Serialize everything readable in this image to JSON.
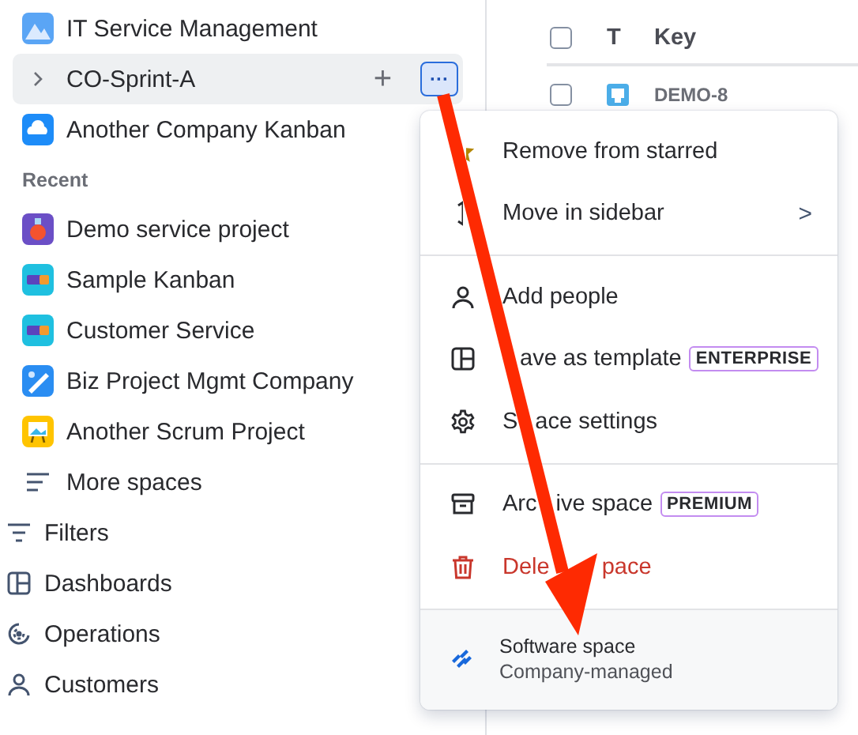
{
  "sidebar": {
    "starred": [
      {
        "label": "IT Service Management",
        "selected": false
      },
      {
        "label": "CO-Sprint-A",
        "selected": true,
        "expanded": false,
        "add_button": "+",
        "more_button": "···"
      },
      {
        "label": "Another Company Kanban",
        "selected": false
      }
    ],
    "recent_heading": "Recent",
    "recent": [
      {
        "label": "Demo service project",
        "selected": false
      },
      {
        "label": "Sample Kanban",
        "selected": false
      },
      {
        "label": "Customer Service",
        "selected": false
      },
      {
        "label": "Biz Project Mgmt Company",
        "selected": false
      },
      {
        "label": "Another Scrum Project",
        "selected": false
      }
    ],
    "more_spaces": "More spaces",
    "nav": [
      {
        "label": "Filters",
        "selected": false
      },
      {
        "label": "Dashboards",
        "selected": false
      },
      {
        "label": "Operations",
        "selected": false
      },
      {
        "label": "Customers",
        "selected": false
      }
    ]
  },
  "table": {
    "columns": [
      "T",
      "Key"
    ],
    "header_checked": false,
    "rows": [
      {
        "key": "DEMO-8",
        "checked": false
      }
    ]
  },
  "menu": {
    "sections": [
      [
        {
          "label": [
            "Remove from starred"
          ],
          "kind": "normal"
        },
        {
          "label": [
            "Move in sidebar"
          ],
          "kind": "submenu",
          "submenu_glyph": ">"
        }
      ],
      [
        {
          "label": [
            "Add people"
          ],
          "kind": "normal"
        },
        {
          "label": [
            "ave as template"
          ],
          "kind": "normal",
          "badge": "ENTERPRISE"
        },
        {
          "label": [
            "S",
            "ace settings"
          ],
          "kind": "normal"
        }
      ],
      [
        {
          "label": [
            "Arc",
            "ive space"
          ],
          "kind": "normal",
          "badge": "PREMIUM"
        },
        {
          "label": [
            "Dele",
            "pace"
          ],
          "kind": "danger"
        }
      ]
    ],
    "footer": {
      "title": "Software space",
      "subtitle": "Company-managed"
    }
  }
}
